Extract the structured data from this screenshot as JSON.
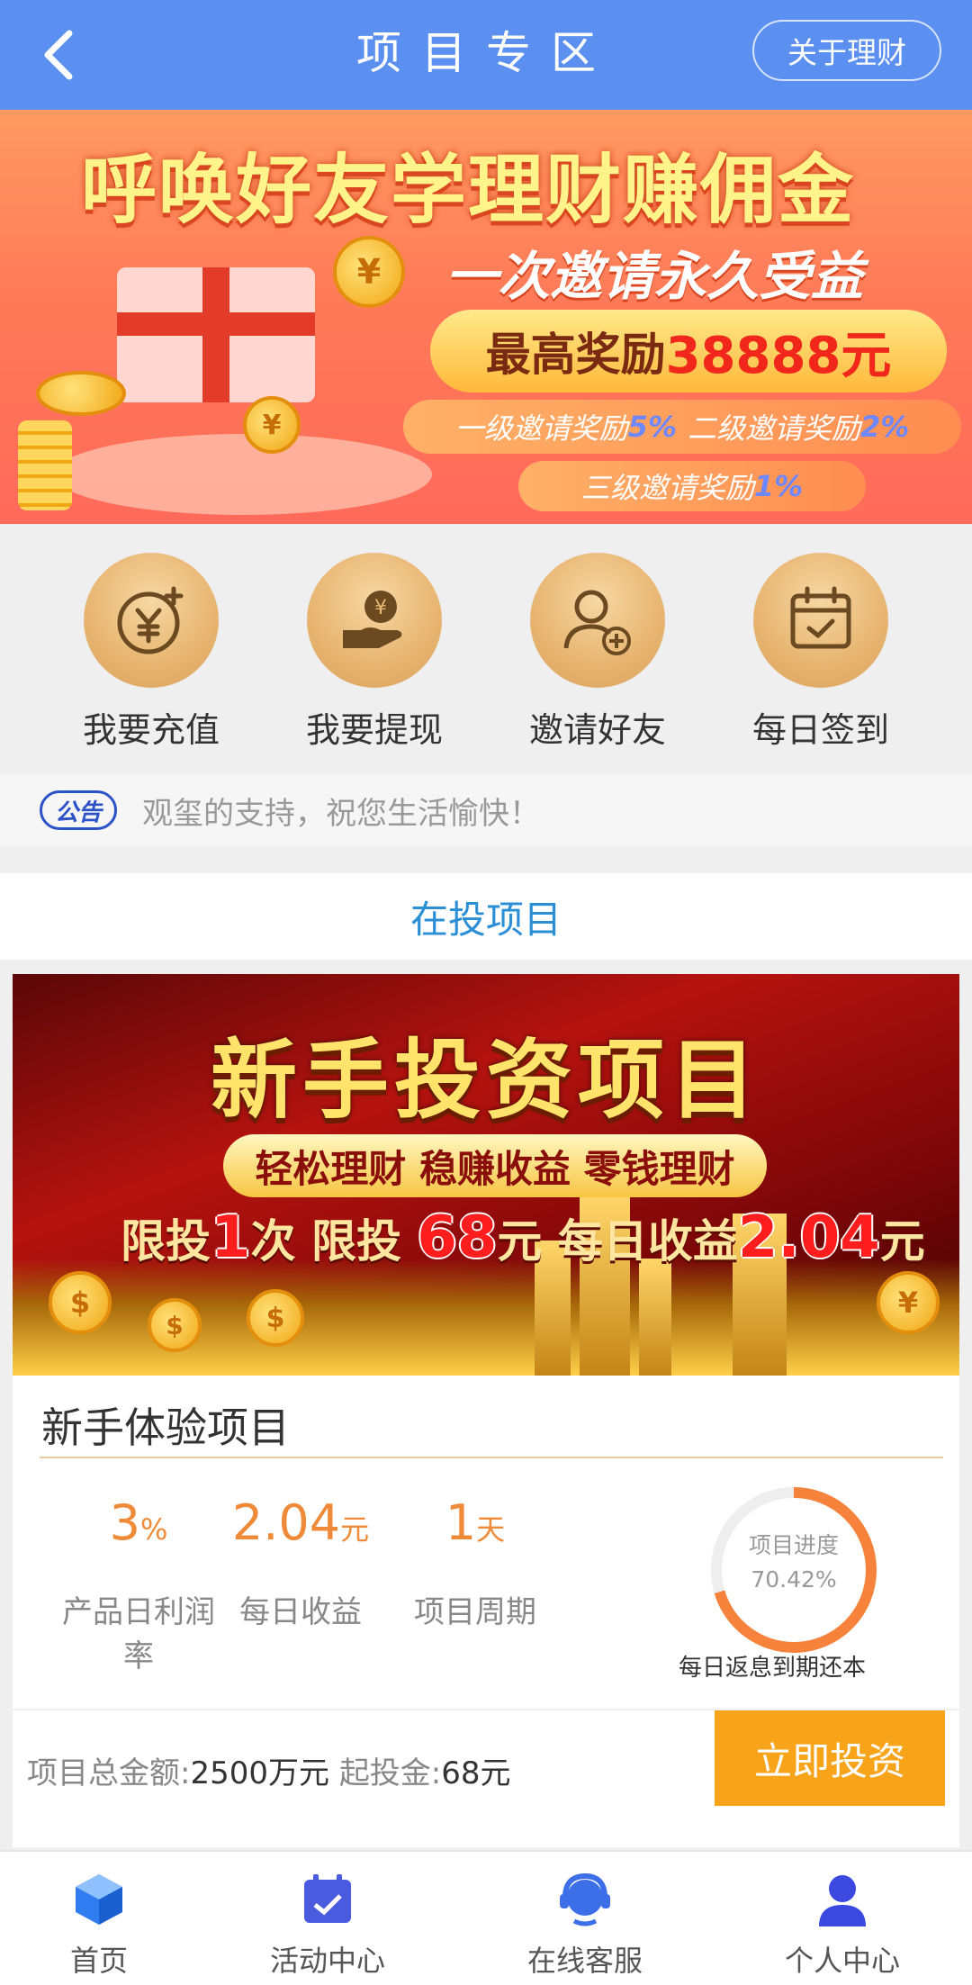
{
  "header": {
    "title": "项目专区",
    "about_label": "关于理财",
    "bg_color": "#5b8ff0"
  },
  "banner": {
    "headline": "呼唤好友学理财赚佣金",
    "subhead": "一次邀请永久受益",
    "reward_prefix": "最高奖励",
    "reward_amount": "38888元",
    "level1_text": "一级邀请奖励",
    "level1_pct": "5%",
    "level2_text": "二级邀请奖励",
    "level2_pct": "2%",
    "level3_text": "三级邀请奖励",
    "level3_pct": "1%"
  },
  "actions": [
    {
      "label": "我要充值",
      "icon": "yuan-plus-icon"
    },
    {
      "label": "我要提现",
      "icon": "hand-money-icon"
    },
    {
      "label": "邀请好友",
      "icon": "add-user-icon"
    },
    {
      "label": "每日签到",
      "icon": "calendar-check-icon"
    }
  ],
  "notice": {
    "tag": "公告",
    "text": "观玺的支持，祝您生活愉快！"
  },
  "section_title": "在投项目",
  "project": {
    "banner_title": "新手投资项目",
    "banner_tagline": "轻松理财 稳赚收益 零钱理财",
    "banner_limit_a": "限投",
    "banner_limit_count": "1",
    "banner_limit_b": "次  限投",
    "banner_limit_amount": "68",
    "banner_limit_c": "元 每日收益",
    "banner_daily": "2.04",
    "banner_unit": "元",
    "name": "新手体验项目",
    "stats": [
      {
        "value": "3",
        "unit": "%",
        "label": "产品日利润率"
      },
      {
        "value": "2.04",
        "unit": "元",
        "label": "每日收益"
      },
      {
        "value": "1",
        "unit": "天",
        "label": "项目周期"
      }
    ],
    "progress_label": "项目进度",
    "progress_value": "70.42%",
    "progress_fraction": 0.7042,
    "progress_caption": "每日返息到期还本",
    "total_label": "项目总金额:",
    "total_value": "2500万元",
    "min_label": "起投金:",
    "min_value": "68元",
    "invest_label": "立即投资",
    "accent_color": "#f8a41b"
  },
  "nav": [
    {
      "label": "首页",
      "icon": "home-cube-icon"
    },
    {
      "label": "活动中心",
      "icon": "calendar-icon"
    },
    {
      "label": "在线客服",
      "icon": "headset-icon"
    },
    {
      "label": "个人中心",
      "icon": "user-icon"
    }
  ]
}
